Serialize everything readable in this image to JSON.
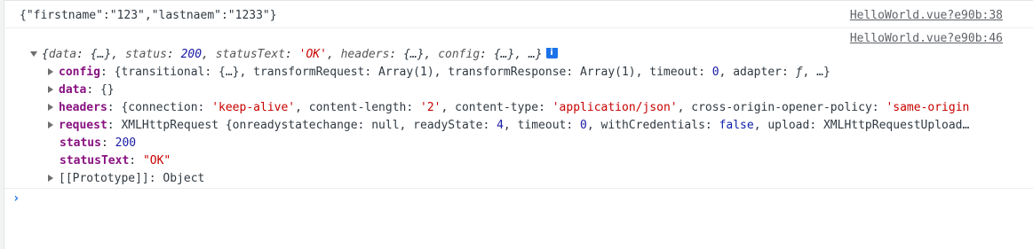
{
  "log1": {
    "text": "{\"firstname\":\"123\",\"lastnaem\":\"1233\"}",
    "source": "HelloWorld.vue?e90b:38"
  },
  "log2": {
    "source": "HelloWorld.vue?e90b:46",
    "summary": {
      "open": "{",
      "data_key": "data",
      "data_val": "{…}",
      "status_key": "status",
      "status_val": "200",
      "statusText_key": "statusText",
      "statusText_val": "'OK'",
      "headers_key": "headers",
      "headers_val": "{…}",
      "config_key": "config",
      "config_val": "{…}",
      "ellipsis": "…}",
      "info_badge": "i"
    },
    "rows": {
      "config": {
        "key": "config",
        "v1": "{transitional: {…}, transformRequest: Array(1), transformResponse: Array(1), timeout: ",
        "num": "0",
        "v2": ", adapter: ",
        "fn": "ƒ",
        "v3": ", …}"
      },
      "data": {
        "key": "data",
        "value": "{}"
      },
      "headers": {
        "key": "headers",
        "p1": "{connection: ",
        "s1": "'keep-alive'",
        "p2": ", content-length: ",
        "s2": "'2'",
        "p3": ", content-type: ",
        "s3": "'application/json'",
        "p4": ", cross-origin-opener-policy: ",
        "s4": "'same-origin"
      },
      "request": {
        "key": "request",
        "p1": "XMLHttpRequest {onreadystatechange: null, readyState: ",
        "n1": "4",
        "p2": ", timeout: ",
        "n2": "0",
        "p3": ", withCredentials: ",
        "b1": "false",
        "p4": ", upload: XMLHttpRequestUpload…"
      },
      "status": {
        "key": "status",
        "value": "200"
      },
      "statusText": {
        "key": "statusText",
        "value": "\"OK\""
      },
      "prototype": {
        "key": "[[Prototype]]",
        "value": "Object"
      }
    }
  },
  "prompt_symbol": "›",
  "colors": {
    "key": "#881280",
    "string": "#c80000",
    "number": "#1a1aa6",
    "link": "#5f6368",
    "prompt": "#1a73e8",
    "info_badge": "#1a73e8"
  }
}
